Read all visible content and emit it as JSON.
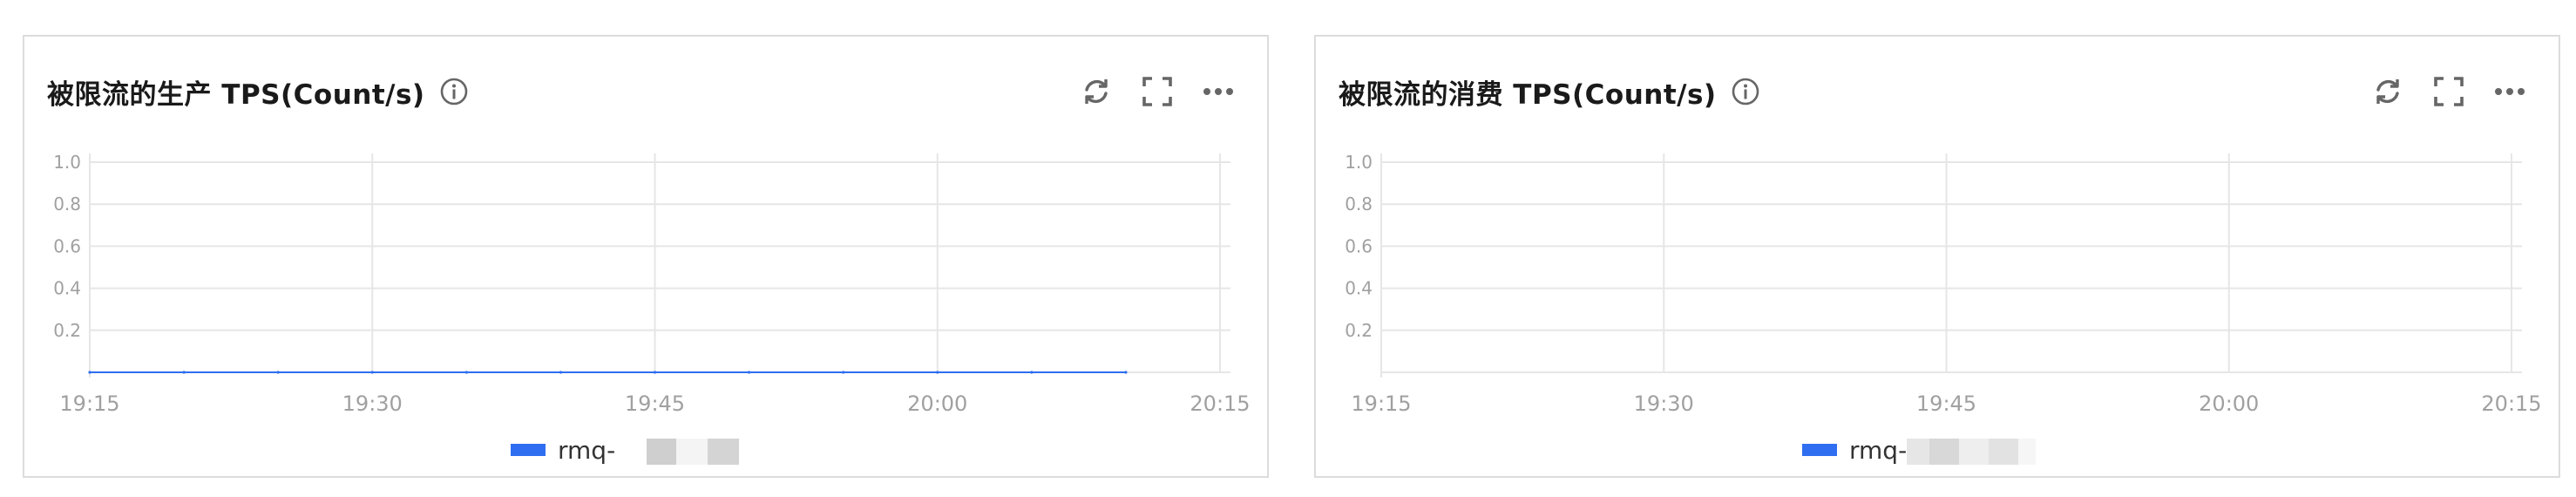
{
  "colors": {
    "series": "#2f6ef0",
    "grid": "#e6e6e6",
    "axis_text": "#a0a0a0",
    "icon": "#666666"
  },
  "panels": [
    {
      "title": "被限流的生产 TPS(Count/s)",
      "icons": {
        "info": "info-icon",
        "refresh": "refresh-icon",
        "fullscreen": "fullscreen-icon",
        "more": "more-icon"
      },
      "legend": {
        "label": "rmq-"
      }
    },
    {
      "title": "被限流的消费 TPS(Count/s)",
      "icons": {
        "info": "info-icon",
        "refresh": "refresh-icon",
        "fullscreen": "fullscreen-icon",
        "more": "more-icon"
      },
      "legend": {
        "label": "rmq-"
      }
    }
  ],
  "chart_data": [
    {
      "type": "line",
      "title": "被限流的生产 TPS(Count/s)",
      "x_ticks": [
        "19:15",
        "19:30",
        "19:45",
        "20:00",
        "20:15"
      ],
      "y_ticks": [
        "1.0",
        "0.8",
        "0.6",
        "0.4",
        "0.2"
      ],
      "ylim": [
        0,
        1.0
      ],
      "xlim": [
        "19:15",
        "20:15"
      ],
      "grid": true,
      "legend_position": "bottom",
      "series": [
        {
          "name": "rmq-",
          "color": "#2f6ef0",
          "x": [
            "19:15",
            "19:20",
            "19:25",
            "19:30",
            "19:35",
            "19:40",
            "19:45",
            "19:50",
            "19:55",
            "20:00",
            "20:05",
            "20:10"
          ],
          "values": [
            0,
            0,
            0,
            0,
            0,
            0,
            0,
            0,
            0,
            0,
            0,
            0
          ]
        }
      ]
    },
    {
      "type": "line",
      "title": "被限流的消费 TPS(Count/s)",
      "x_ticks": [
        "19:15",
        "19:30",
        "19:45",
        "20:00",
        "20:15"
      ],
      "y_ticks": [
        "1.0",
        "0.8",
        "0.6",
        "0.4",
        "0.2"
      ],
      "ylim": [
        0,
        1.0
      ],
      "xlim": [
        "19:15",
        "20:15"
      ],
      "grid": true,
      "legend_position": "bottom",
      "series": [
        {
          "name": "rmq-",
          "color": "#2f6ef0",
          "x": [],
          "values": []
        }
      ]
    }
  ]
}
